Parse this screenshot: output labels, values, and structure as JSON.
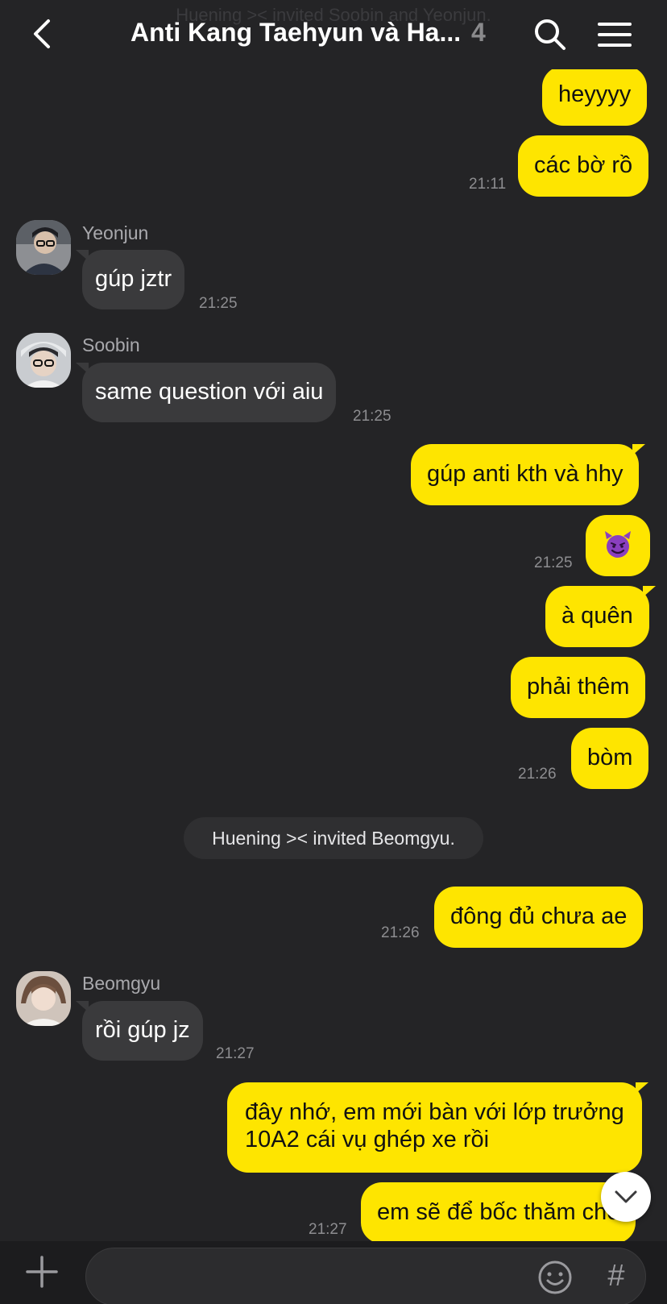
{
  "header": {
    "ghost_text": "Huening >< invited Soobin and Yeonjun.",
    "title": "Anti Kang Taehyun và Ha...",
    "member_count": "4"
  },
  "messages": [
    {
      "side": "me",
      "text": "heyyyy"
    },
    {
      "side": "me",
      "text": "các bờ rồ",
      "time": "21:11"
    },
    {
      "side": "other",
      "sender": "Yeonjun",
      "text": "gúp jztr",
      "time": "21:25"
    },
    {
      "side": "other",
      "sender": "Soobin",
      "text": "same question với aiu",
      "time": "21:25"
    },
    {
      "side": "me",
      "text": "gúp anti kth và hhy"
    },
    {
      "side": "me",
      "text": "😈",
      "time": "21:25"
    },
    {
      "side": "me",
      "text": "à quên"
    },
    {
      "side": "me",
      "text": "phải thêm"
    },
    {
      "side": "me",
      "text": "bòm",
      "time": "21:26"
    },
    {
      "side": "system",
      "text": "Huening >< invited Beomgyu."
    },
    {
      "side": "me",
      "text": "đông đủ chưa ae",
      "time": "21:26"
    },
    {
      "side": "other",
      "sender": "Beomgyu",
      "text": "rồi gúp jz",
      "time": "21:27"
    },
    {
      "side": "me",
      "text": "đây nhớ, em mới bàn với lớp trưởng",
      "text2": "10A2 cái vụ ghép xe rồi"
    },
    {
      "side": "me",
      "text": "em sẽ để bốc thăm cho",
      "time": "21:27"
    }
  ],
  "colors": {
    "background": "#242426",
    "my_bubble": "#fee500",
    "other_bubble": "#3a3a3c"
  },
  "icons": {
    "back": "chevron-left-icon",
    "search": "search-icon",
    "menu": "hamburger-menu-icon",
    "add": "plus-icon",
    "emoji": "smiley-icon",
    "hashtag": "hashtag-icon",
    "scroll": "chevron-down-icon"
  },
  "bottom": {
    "hash_symbol": "#",
    "input_value": ""
  }
}
